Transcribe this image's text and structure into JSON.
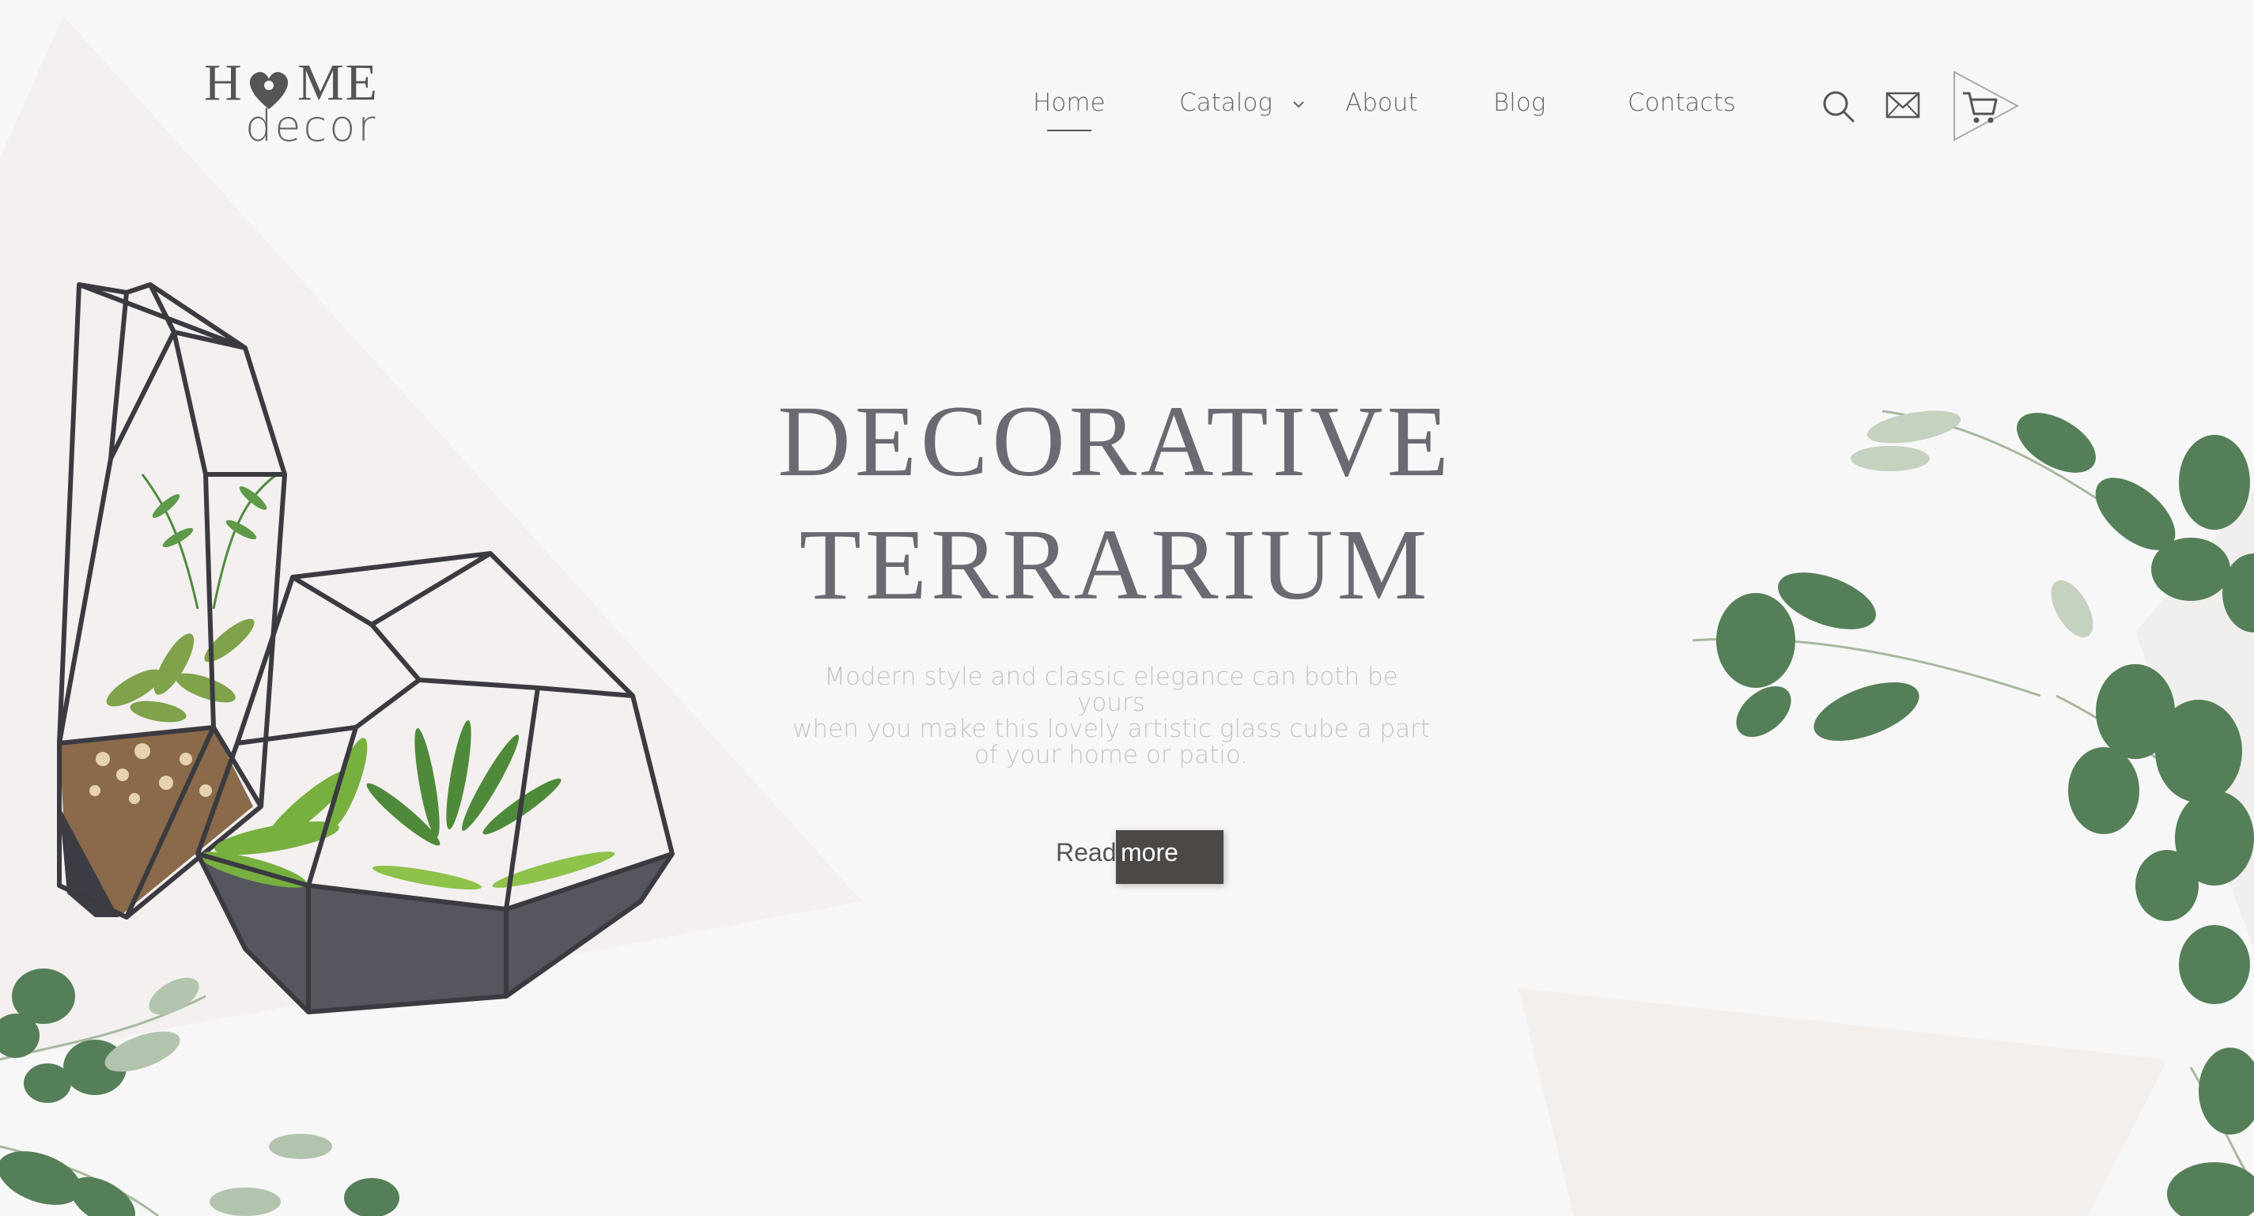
{
  "brand": {
    "logo_top_left": "H",
    "logo_top_right": "ME",
    "logo_bottom": "decor"
  },
  "nav": {
    "items": [
      {
        "label": "Home",
        "active": true
      },
      {
        "label": "Catalog",
        "has_dropdown": true
      },
      {
        "label": "About"
      },
      {
        "label": "Blog"
      },
      {
        "label": "Contacts"
      }
    ]
  },
  "header_icons": [
    "search-icon",
    "mail-icon",
    "cart-icon"
  ],
  "hero": {
    "title_line1": "DECORATIVE",
    "title_line2": "TERRARIUM",
    "subtitle_line1": "Modern style and classic elegance can both be yours",
    "subtitle_line2": "when you make this lovely artistic glass cube a part",
    "subtitle_line3": "of your home or patio.",
    "cta_read": "Read",
    "cta_more": "more"
  },
  "colors": {
    "background": "#f7f7f7",
    "title": "#6a6a72",
    "text": "#666666",
    "subtitle": "#c4c4c4",
    "button": "#4b4846",
    "leaf": "#4f7a55"
  }
}
